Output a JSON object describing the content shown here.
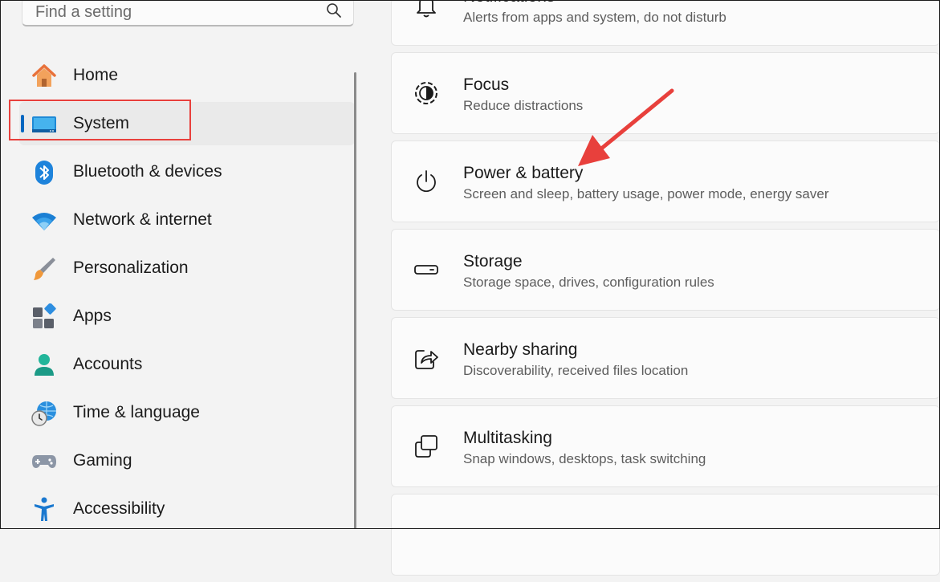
{
  "search": {
    "placeholder": "Find a setting",
    "icon": "search-icon"
  },
  "sidebar": {
    "items": [
      {
        "label": "Home",
        "icon": "home-icon"
      },
      {
        "label": "System",
        "icon": "system-icon",
        "selected": true
      },
      {
        "label": "Bluetooth & devices",
        "icon": "bluetooth-icon"
      },
      {
        "label": "Network & internet",
        "icon": "wifi-icon"
      },
      {
        "label": "Personalization",
        "icon": "brush-icon"
      },
      {
        "label": "Apps",
        "icon": "apps-icon"
      },
      {
        "label": "Accounts",
        "icon": "account-icon"
      },
      {
        "label": "Time & language",
        "icon": "globe-clock-icon"
      },
      {
        "label": "Gaming",
        "icon": "gamepad-icon"
      },
      {
        "label": "Accessibility",
        "icon": "accessibility-icon"
      }
    ]
  },
  "main": {
    "cards": [
      {
        "title": "Notifications",
        "subtitle": "Alerts from apps and system, do not disturb",
        "icon": "bell-icon"
      },
      {
        "title": "Focus",
        "subtitle": "Reduce distractions",
        "icon": "focus-icon"
      },
      {
        "title": "Power & battery",
        "subtitle": "Screen and sleep, battery usage, power mode, energy saver",
        "icon": "power-icon"
      },
      {
        "title": "Storage",
        "subtitle": "Storage space, drives, configuration rules",
        "icon": "storage-icon"
      },
      {
        "title": "Nearby sharing",
        "subtitle": "Discoverability, received files location",
        "icon": "share-icon"
      },
      {
        "title": "Multitasking",
        "subtitle": "Snap windows, desktops, task switching",
        "icon": "multitasking-icon"
      }
    ]
  },
  "colors": {
    "accent": "#0067c0",
    "annotation": "#e8403c"
  }
}
